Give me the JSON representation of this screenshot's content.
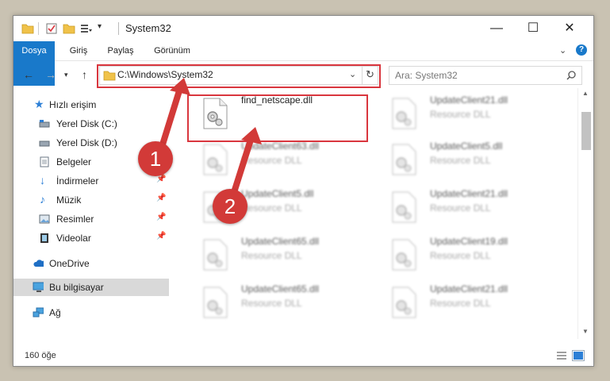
{
  "window": {
    "title": "System32"
  },
  "ribbon": {
    "tabs": [
      "Dosya",
      "Giriş",
      "Paylaş",
      "Görünüm"
    ]
  },
  "address": {
    "path": "C:\\Windows\\System32",
    "search_placeholder": "Ara: System32"
  },
  "sidebar": {
    "quick_access": "Hızlı erişim",
    "items": [
      "Yerel Disk (C:)",
      "Yerel Disk (D:)",
      "Belgeler",
      "İndirmeler",
      "Müzik",
      "Resimler",
      "Videolar"
    ],
    "onedrive": "OneDrive",
    "this_pc": "Bu bilgisayar",
    "network": "Ağ"
  },
  "files": {
    "main": {
      "name": "find_netscape.dll"
    },
    "left": [
      {
        "name": "UpdateClient63.dll",
        "type": "Resource DLL"
      },
      {
        "name": "UpdateClient5.dll",
        "type": "Resource DLL"
      },
      {
        "name": "UpdateClient65.dll",
        "type": "Resource DLL"
      },
      {
        "name": "UpdateClient65.dll",
        "type": "Resource DLL"
      }
    ],
    "right": [
      {
        "name": "UpdateClient21.dll",
        "type": "Resource DLL"
      },
      {
        "name": "UpdateClient5.dll",
        "type": "Resource DLL"
      },
      {
        "name": "UpdateClient21.dll",
        "type": "Resource DLL"
      },
      {
        "name": "UpdateClient19.dll",
        "type": "Resource DLL"
      },
      {
        "name": "UpdateClient21.dll",
        "type": "Resource DLL"
      }
    ]
  },
  "status": {
    "count": "160 öğe"
  },
  "badges": {
    "one": "1",
    "two": "2"
  },
  "colors": {
    "accent": "#1979ca",
    "highlight": "#d9363e",
    "badge": "#d23a38"
  }
}
